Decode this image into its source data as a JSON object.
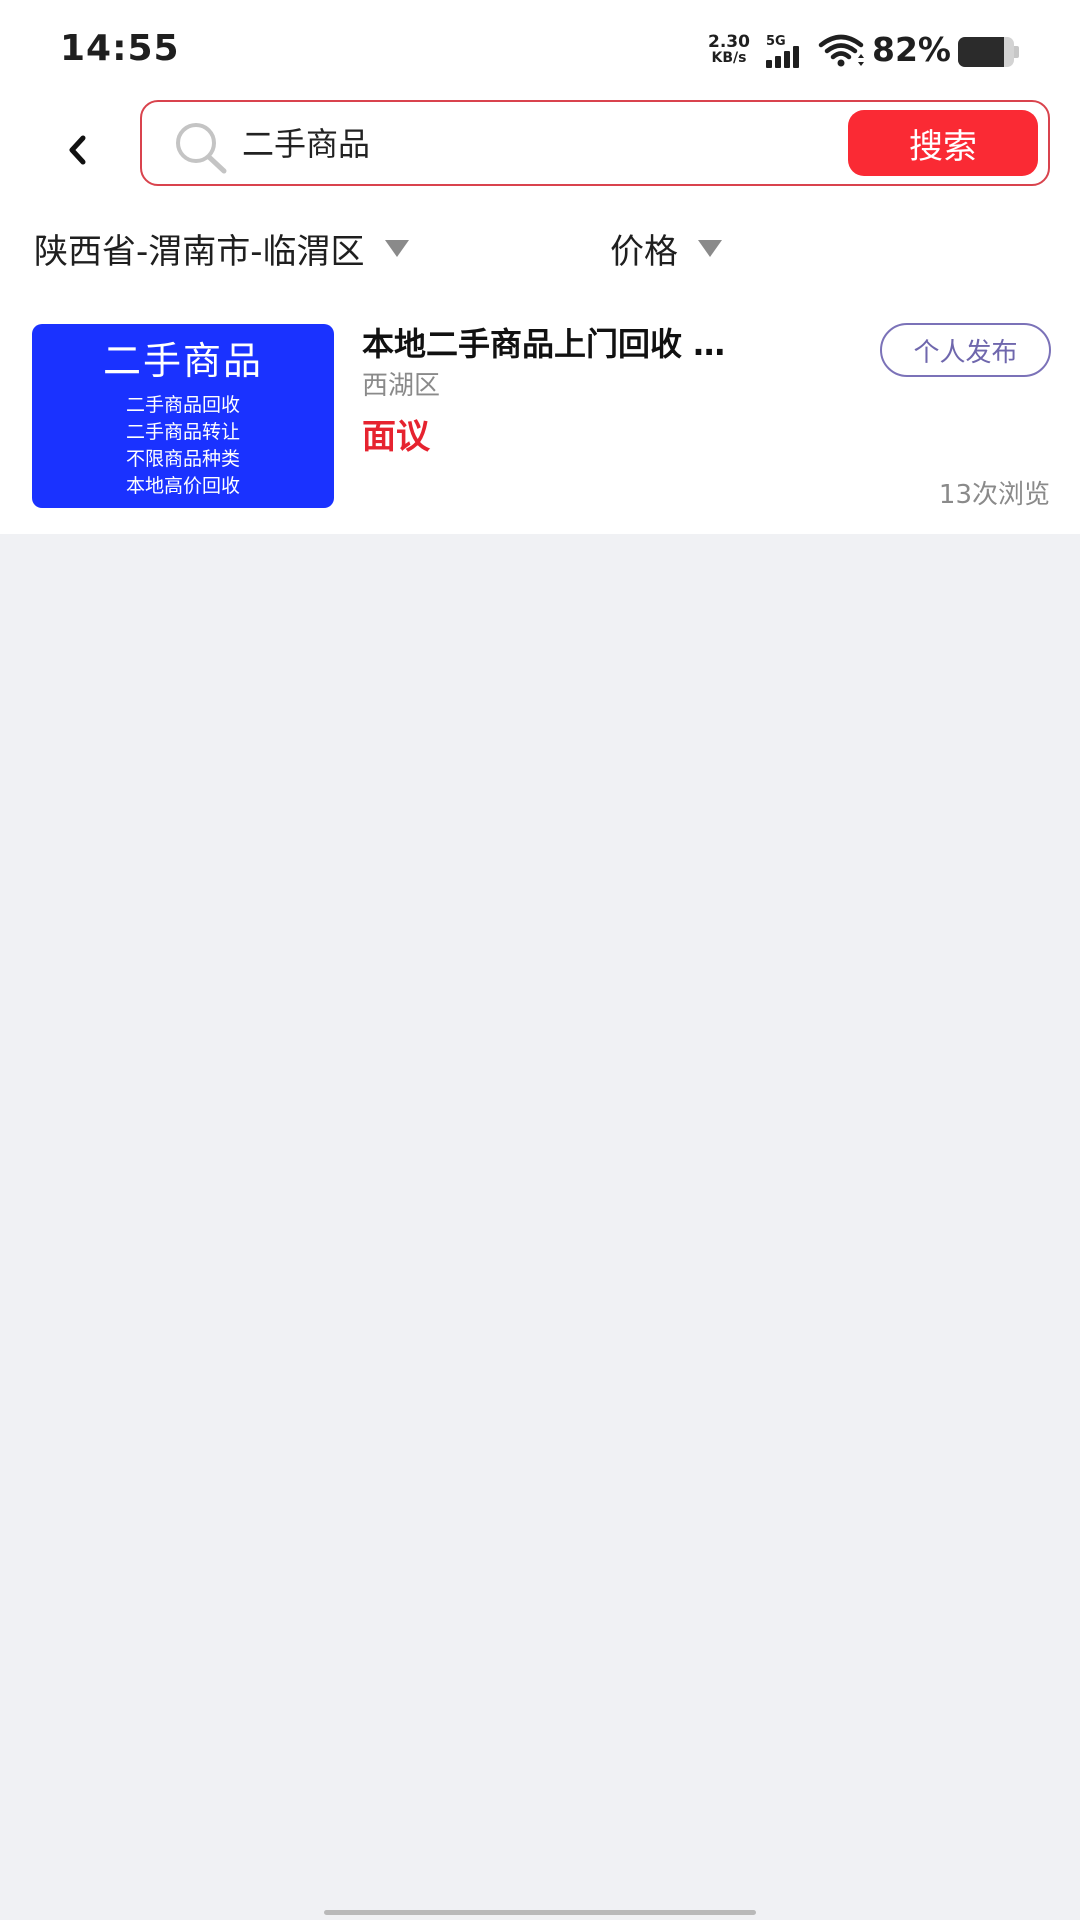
{
  "status_bar": {
    "time": "14:55",
    "net_speed_value": "2.30",
    "net_speed_unit": "KB/s",
    "network_type": "5G",
    "battery_percent": "82%",
    "battery_level": 0.82
  },
  "search": {
    "query": "二手商品",
    "button_label": "搜索",
    "border_color": "#d9434d",
    "button_color": "#fa2a34"
  },
  "filters": {
    "region": "陕西省-渭南市-临渭区",
    "price": "价格"
  },
  "listings": [
    {
      "thumbnail": {
        "title": "二手商品",
        "lines": [
          "二手商品回收",
          "二手商品转让",
          "不限商品种类",
          "本地高价回收"
        ],
        "background": "#1a32ff"
      },
      "title": "本地二手商品上门回收 …",
      "region": "西湖区",
      "price": "面议",
      "tag": "个人发布",
      "views": "13次浏览"
    }
  ],
  "icons": {
    "back": "chevron-left-icon",
    "search": "search-icon",
    "signal": "signal-icon",
    "wifi": "wifi-icon",
    "battery": "battery-icon",
    "dropdown": "triangle-down-icon"
  }
}
